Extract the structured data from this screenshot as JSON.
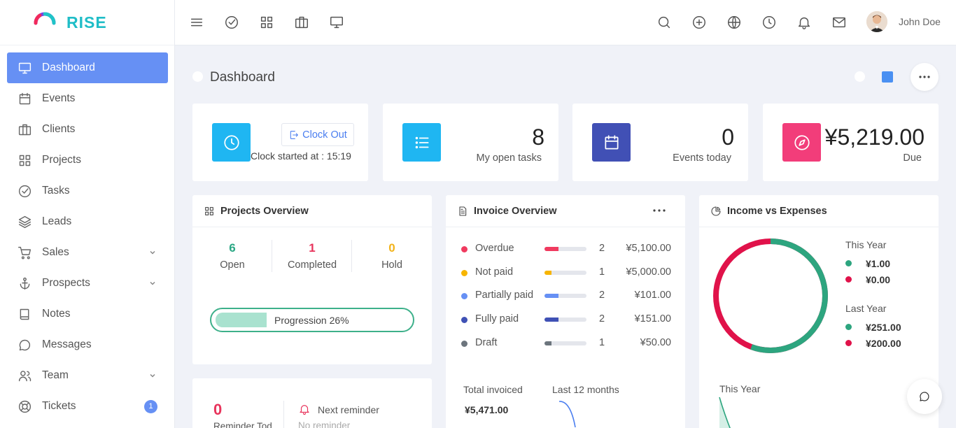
{
  "brand": {
    "name": "RISE"
  },
  "sidebar": {
    "items": [
      {
        "label": "Dashboard",
        "icon": "monitor-icon",
        "active": true
      },
      {
        "label": "Events",
        "icon": "calendar-icon"
      },
      {
        "label": "Clients",
        "icon": "briefcase-icon"
      },
      {
        "label": "Projects",
        "icon": "grid-icon"
      },
      {
        "label": "Tasks",
        "icon": "check-circle-icon"
      },
      {
        "label": "Leads",
        "icon": "layers-icon"
      },
      {
        "label": "Sales",
        "icon": "cart-icon",
        "has_submenu": true
      },
      {
        "label": "Prospects",
        "icon": "anchor-icon",
        "has_submenu": true
      },
      {
        "label": "Notes",
        "icon": "book-icon"
      },
      {
        "label": "Messages",
        "icon": "message-icon"
      },
      {
        "label": "Team",
        "icon": "users-icon",
        "has_submenu": true
      },
      {
        "label": "Tickets",
        "icon": "lifebuoy-icon",
        "badge": "1"
      }
    ]
  },
  "topbar": {
    "left_icons": [
      "menu-icon",
      "check-circle-icon",
      "grid-icon",
      "briefcase-icon",
      "monitor-icon"
    ],
    "right_icons": [
      "search-icon",
      "plus-circle-icon",
      "globe-icon",
      "clock-icon",
      "bell-icon",
      "mail-icon"
    ],
    "user_name": "John Doe"
  },
  "page": {
    "title": "Dashboard",
    "accent_color": "#4a90f2"
  },
  "clock_card": {
    "button_label": "Clock Out",
    "started_text": "Clock started at : 15:19",
    "icon_color": "#1fb6f2"
  },
  "stats": [
    {
      "value": "8",
      "label": "My open tasks",
      "icon": "list-icon",
      "color": "#1fb6f2"
    },
    {
      "value": "0",
      "label": "Events today",
      "icon": "calendar-icon",
      "color": "#4150b5"
    },
    {
      "value": "¥5,219.00",
      "label": "Due",
      "icon": "compass-icon",
      "color": "#f23d7a"
    }
  ],
  "projects_overview": {
    "title": "Projects Overview",
    "columns": [
      {
        "value": "6",
        "label": "Open",
        "color": "#2aa784"
      },
      {
        "value": "1",
        "label": "Completed",
        "color": "#e8345c"
      },
      {
        "value": "0",
        "label": "Hold",
        "color": "#f2b31b"
      }
    ],
    "progress_label": "Progression 26%",
    "progress_value": 26
  },
  "reminder_card": {
    "count": "0",
    "count_label": "Reminder Tod",
    "next_label": "Next reminder",
    "next_value": "No reminder"
  },
  "invoice_overview": {
    "title": "Invoice Overview",
    "rows": [
      {
        "name": "Overdue",
        "count": "2",
        "amount": "¥5,100.00",
        "color": "#f03a5f",
        "fill": 0.33
      },
      {
        "name": "Not paid",
        "count": "1",
        "amount": "¥5,000.00",
        "color": "#f7b500",
        "fill": 0.17
      },
      {
        "name": "Partially paid",
        "count": "2",
        "amount": "¥101.00",
        "color": "#6690f4",
        "fill": 0.33
      },
      {
        "name": "Fully paid",
        "count": "2",
        "amount": "¥151.00",
        "color": "#3f51b5",
        "fill": 0.33
      },
      {
        "name": "Draft",
        "count": "1",
        "amount": "¥50.00",
        "color": "#6c757d",
        "fill": 0.17
      }
    ],
    "total_label": "Total invoiced",
    "total_value": "¥5,471.00",
    "period_label": "Last 12 months"
  },
  "income_expenses": {
    "title": "Income vs Expenses",
    "this_year_label": "This Year",
    "this_year": [
      {
        "value": "¥1.00",
        "color": "#2da57f"
      },
      {
        "value": "¥0.00",
        "color": "#e0124a"
      }
    ],
    "last_year_label": "Last Year",
    "last_year": [
      {
        "value": "¥251.00",
        "color": "#2da57f"
      },
      {
        "value": "¥200.00",
        "color": "#e0124a"
      }
    ],
    "donut_income_fraction": 0.557,
    "chart_this_year_label": "This Year"
  }
}
